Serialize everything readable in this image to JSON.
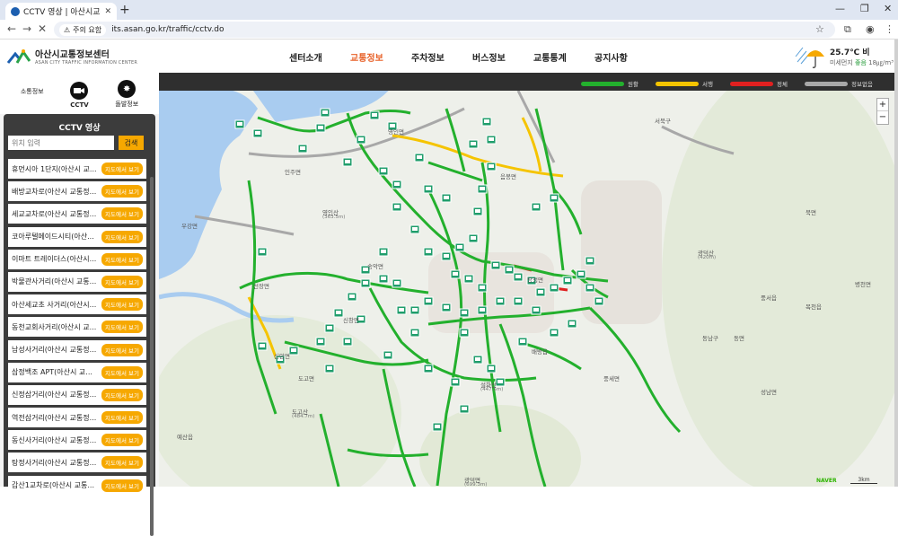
{
  "browser": {
    "tab_title": "CCTV 영상 | 아산시교통정보센",
    "url": "its.asan.go.kr/traffic/cctv.do",
    "security_label": "주의 요함"
  },
  "site": {
    "logo_korean": "아산시교통정보센터",
    "logo_english": "ASAN CITY TRAFFIC INFORMATION CENTER",
    "nav": [
      "센터소개",
      "교통정보",
      "주차정보",
      "버스정보",
      "교통통계",
      "공지사항"
    ],
    "active_nav": "교통정보",
    "weather": {
      "temp": "25.7℃ 비",
      "dust_label": "미세먼지",
      "dust_status": "좋음",
      "dust_value": "18㎍/m³"
    }
  },
  "sidebar": {
    "quick": [
      {
        "label": "소통정보",
        "icon": "none"
      },
      {
        "label": "CCTV",
        "icon": "cctv-camera-icon"
      },
      {
        "label": "돌발정보",
        "icon": "incident-burst-icon"
      }
    ],
    "panel_title": "CCTV 영상",
    "search_placeholder": "위치 입력",
    "search_button": "검색",
    "map_button": "지도에서 보기",
    "cameras": [
      "휴먼시아 1단지(아산시 교...",
      "배방교차로(아산시 교통정...",
      "세교교차로(아산시 교통정...",
      "코아루텔메이드시티(아산...",
      "이마트 트레이더스(아산시...",
      "박물관사거리(아산시 교통...",
      "아산세교초 사거리(아산시...",
      "동천교회사거리(아산시 교...",
      "남성사거리(아산시 교통정...",
      "삼정백조 APT(아산시 교...",
      "신정삼거리(아산시 교통정...",
      "역전삼거리(아산시 교통정...",
      "동신사거리(아산시 교통정...",
      "탕정사거리(아산시 교통정...",
      "갑산1교차로(아산시 교통..."
    ]
  },
  "map": {
    "legend": [
      {
        "label": "원활",
        "color": "#23b02d"
      },
      {
        "label": "서행",
        "color": "#f5c400"
      },
      {
        "label": "정체",
        "color": "#e02020"
      },
      {
        "label": "정보없음",
        "color": "#a8a8a8"
      }
    ],
    "place_labels": [
      "서북구",
      "동남구",
      "영인면",
      "인주면",
      "음봉면",
      "탕정면",
      "배방읍",
      "풍세면",
      "송악면",
      "도고면",
      "선장면",
      "우강면",
      "신창면",
      "예산읍",
      "광덕면",
      "성남면",
      "목천읍",
      "병천면",
      "북면",
      "풍서읍",
      "동면",
      "신암면",
      "영인산",
      "도고산",
      "설화산",
      "광덕산"
    ],
    "mountain_heights": [
      "(363.5m)",
      "(484.7m)",
      "(447.5m)",
      "(699.3m)",
      "(420m)"
    ],
    "zoom_in": "+",
    "zoom_out": "−",
    "attribution": "NAVER",
    "scale": "3km"
  }
}
